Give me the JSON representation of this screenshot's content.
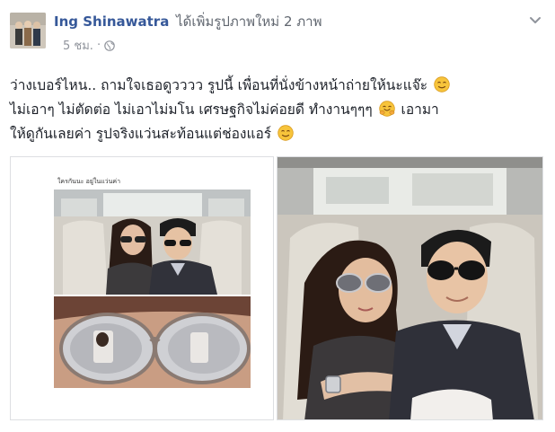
{
  "header": {
    "author": "Ing Shinawatra",
    "action": "ได้เพิ่มรูปภาพใหม่ 2 ภาพ"
  },
  "meta": {
    "time": "5 ชม.",
    "separator": "·",
    "privacy_icon": "globe-icon"
  },
  "menu": {
    "icon": "chevron-down-icon"
  },
  "post": {
    "line1": "ว่างเบอร์ไหน.. ถามใจเธอดูวววว รูปนี้ เพื่อนที่นั่งข้างหน้าถ่ายให้นะแจ๊ะ",
    "line2a": "ไม่เอาๆ ไม่ตัดต่อ ไม่เอาไม่มโน เศรษฐกิจไม่ค่อยดี ทำงานๆๆๆ",
    "line2b": "เอามา",
    "line3": "ให้ดูกันเลยค่า รูปจริงแว่นสะท้อนแต่ช่องแอร์"
  },
  "emojis": {
    "relieved": "relieved-face-emoji",
    "hugging": "hugging-face-emoji"
  },
  "photos": {
    "left_caption": "ใครกันนะ อยู่ในแว่นค่า"
  },
  "colors": {
    "link": "#365899",
    "text": "#1d2129",
    "meta": "#90949c",
    "border": "#dddfe2"
  }
}
